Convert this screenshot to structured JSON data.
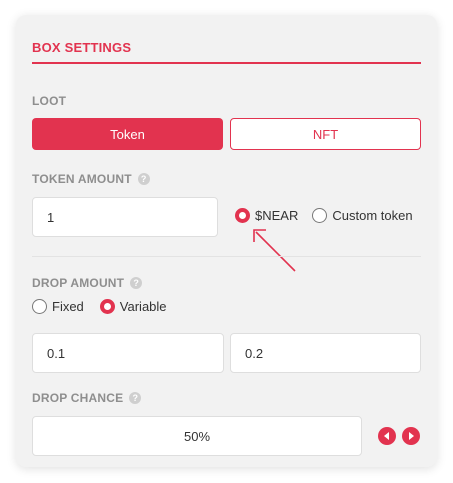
{
  "box_settings": {
    "title": "BOX SETTINGS"
  },
  "loot": {
    "label": "LOOT",
    "options": [
      "Token",
      "NFT"
    ],
    "selected": "Token"
  },
  "token_amount": {
    "label": "TOKEN AMOUNT",
    "value": "1",
    "currency_options": [
      "$NEAR",
      "Custom token"
    ],
    "selected_currency": "$NEAR"
  },
  "drop_amount": {
    "label": "DROP AMOUNT",
    "mode_options": [
      "Fixed",
      "Variable"
    ],
    "selected_mode": "Variable",
    "min_value": "0.1",
    "max_value": "0.2"
  },
  "drop_chance": {
    "label": "DROP CHANCE",
    "value": "50%"
  },
  "colors": {
    "accent": "#e2334f",
    "panel": "#f2f2f2",
    "muted_label": "#8e8e8e"
  },
  "icons": [
    "help-icon",
    "arrow-annotation-icon",
    "decrement-icon",
    "increment-icon"
  ]
}
